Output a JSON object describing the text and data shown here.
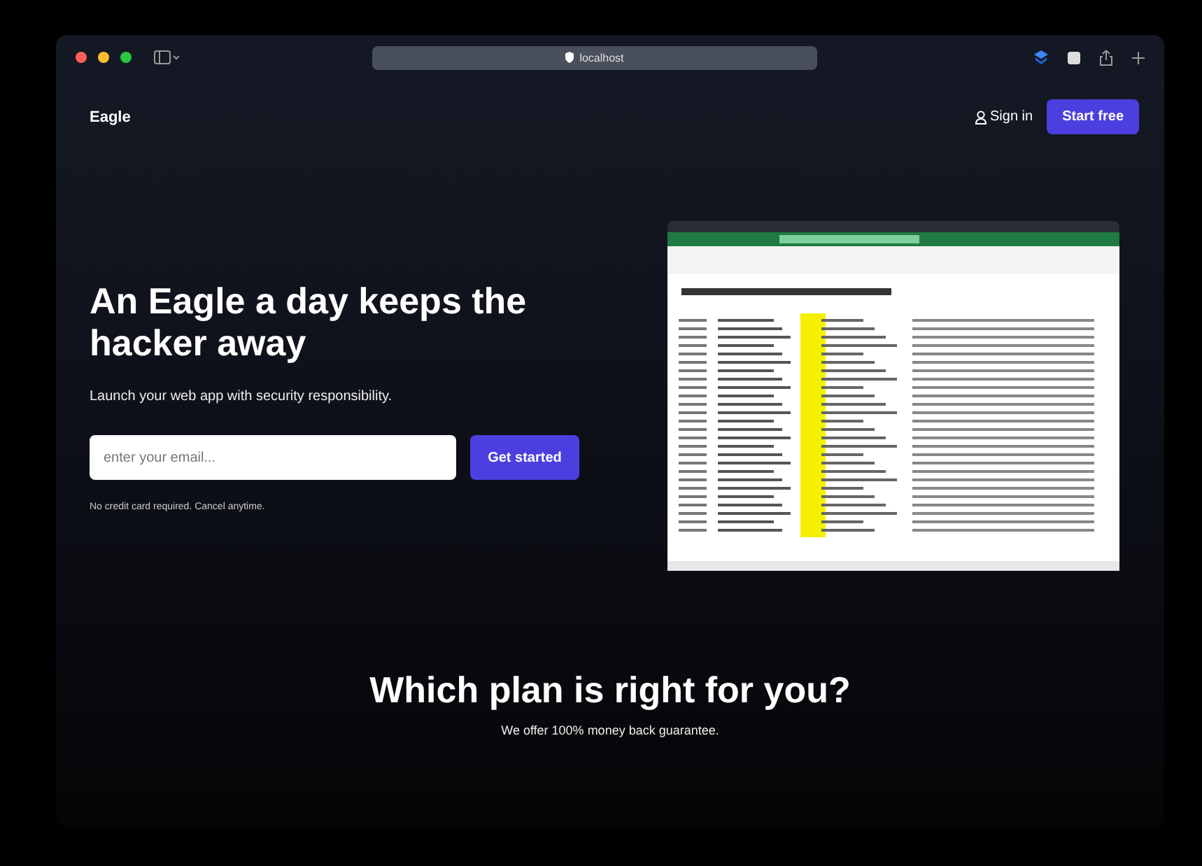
{
  "browser": {
    "address": "localhost"
  },
  "nav": {
    "brand": "Eagle",
    "sign_in": "Sign in",
    "cta": "Start free"
  },
  "hero": {
    "title": "An Eagle a day keeps the hacker away",
    "subtitle": "Launch your web app with security responsibility.",
    "email": {
      "placeholder": "enter your email..."
    },
    "button": "Get started",
    "note": "No credit card required. Cancel anytime."
  },
  "pricing": {
    "title": "Which plan is right for you?",
    "subtitle": "We offer 100% money back guarantee."
  }
}
